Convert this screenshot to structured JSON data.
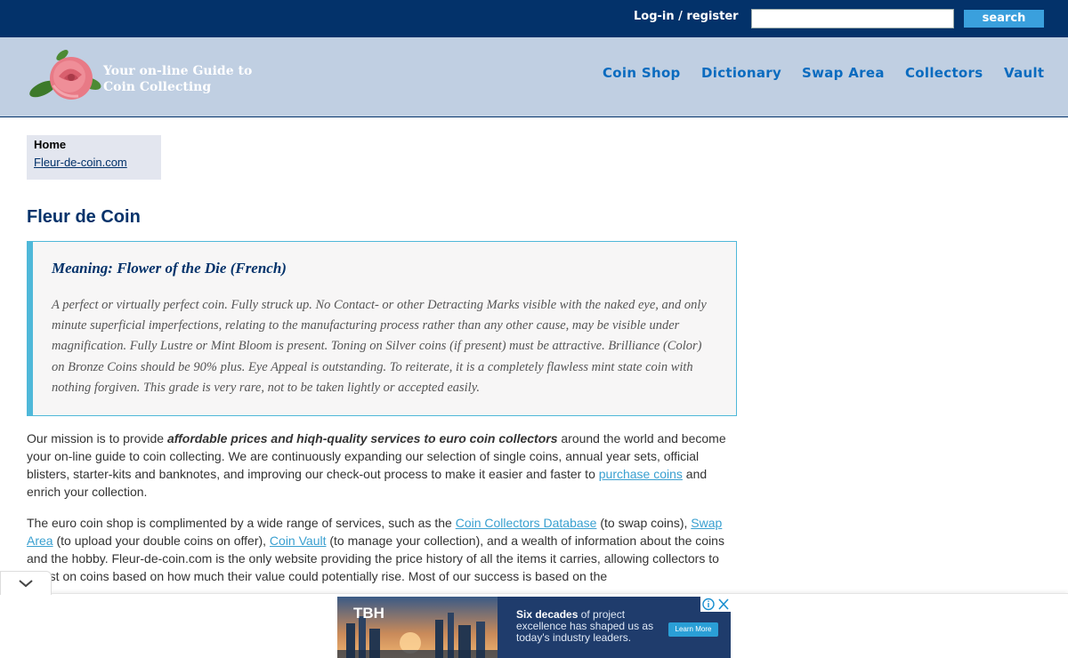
{
  "topbar": {
    "login_label": "Log-in / register",
    "search_placeholder": "",
    "search_button": "search"
  },
  "header": {
    "tagline_line1": "Your on-line Guide to",
    "tagline_line2": "Coin Collecting",
    "nav": [
      "Coin Shop",
      "Dictionary",
      "Swap Area",
      "Collectors",
      "Vault"
    ]
  },
  "breadcrumb": {
    "home": "Home",
    "link": "Fleur-de-coin.com"
  },
  "page_title": "Fleur de Coin",
  "definition": {
    "meaning": "Meaning: Flower of the Die (French)",
    "text": "A perfect or virtually perfect coin. Fully struck up. No Contact- or other Detracting Marks visible with the naked eye, and only minute superficial imperfections, relating to the manufacturing process rather than any other cause, may be visible under magnification. Fully Lustre or Mint Bloom is present. Toning on Silver coins (if present) must be attractive. Brilliance (Color) on Bronze Coins should be 90% plus. Eye Appeal is outstanding. To reiterate, it is a completely flawless mint state coin with nothing forgiven. This grade is very rare, not to be taken lightly or accepted easily."
  },
  "paragraph1": {
    "a": "Our mission is to provide ",
    "b_bold": "affordable prices and hiqh-quality services to euro coin collectors",
    "c": " around the world and become your on-line guide to coin collecting. We are continuously expanding our selection of single coins, annual year sets, official blisters, starter-kits and banknotes, and improving our check-out process to make it easier and faster to ",
    "link_purchase": "purchase coins",
    "d": " and enrich your collection."
  },
  "paragraph2": {
    "a": "The euro coin shop is complimented by a wide range of services, such as the ",
    "link_db": "Coin Collectors Database",
    "b": " (to swap coins), ",
    "link_swap": "Swap Area",
    "c": " (to upload your double coins on offer), ",
    "link_vault": "Coin Vault",
    "d": " (to manage your collection), and a wealth of information about the coins and the hobby. Fleur-de-coin.com is the only website providing the price history of all the items it carries, allowing collectors to invest on coins based on how much their value could potentially rise. Most of our success is based on the"
  },
  "ad": {
    "brand": "TBH",
    "text_bold": "Six decades",
    "text_rest": " of project excellence has shaped us as today's industry leaders.",
    "cta": "Learn More"
  },
  "colors": {
    "topbar": "#03326a",
    "header_bg": "#c0cfe2",
    "nav_link": "#0a6bbf",
    "accent": "#4fb8d9",
    "link": "#3aa0d0"
  }
}
